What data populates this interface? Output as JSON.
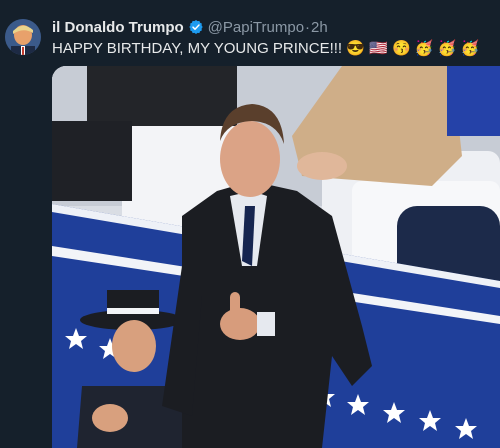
{
  "tweet": {
    "display_name": "il Donaldo Trumpo",
    "handle": "@PapiTrumpo",
    "separator": "·",
    "time": "2h",
    "text": "HAPPY BIRTHDAY, MY YOUNG PRINCE!!! 😎 🇺🇸 😚 🥳 🥳 🥳",
    "avatar_icon": "avatar-profile-photo",
    "verified_icon": "verified-badge-icon",
    "verified_color": "#1d9bf0"
  },
  "media": {
    "icon": "photo-young-man-in-suit-thumbs-up-at-event",
    "colors": {
      "stage_blue": "#1f3f9a",
      "stripe_white": "#f2f4f8",
      "suit_dark": "#1b1d22",
      "star_white": "#ffffff"
    }
  }
}
